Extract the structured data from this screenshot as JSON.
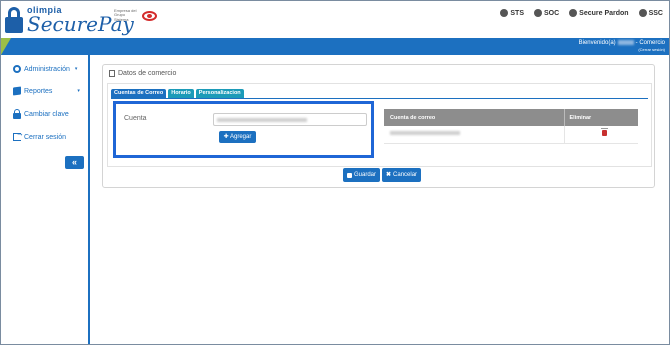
{
  "brand": {
    "logo_small": "olimpia",
    "logo_big": "SecurePay",
    "seal_text": "Empresa del Grupo Sistema"
  },
  "certifications": [
    "STS",
    "SOC",
    "Secure Pardon",
    "SSC"
  ],
  "header": {
    "welcome": "Bienvenido(a)",
    "role": "- Comercio",
    "logout": "(Cerrar sesión)"
  },
  "sidebar": {
    "items": [
      {
        "label": "Administración",
        "icon": "gauge-icon",
        "caret": "▾"
      },
      {
        "label": "Reportes",
        "icon": "book-icon",
        "caret": "▾"
      },
      {
        "label": "Cambiar clave",
        "icon": "lock-icon",
        "caret": ""
      },
      {
        "label": "Cerrar sesión",
        "icon": "exit-icon",
        "caret": ""
      }
    ],
    "collapse": "«"
  },
  "panel": {
    "title": "Datos de comercio",
    "tabs": [
      "Cuentas de Correo",
      "Horario",
      "Personalizacion"
    ],
    "active_tab": 0,
    "form": {
      "label": "Cuenta",
      "add_button": "Agregar"
    },
    "table": {
      "headers": [
        "Cuenta de correo",
        "Eliminar"
      ]
    },
    "buttons": {
      "save": "Guardar",
      "cancel": "Cancelar"
    }
  },
  "colors": {
    "primary": "#1c70c0",
    "tab": "#1c9bb8",
    "highlight": "#1f66d6",
    "accent": "#9cbf47"
  }
}
